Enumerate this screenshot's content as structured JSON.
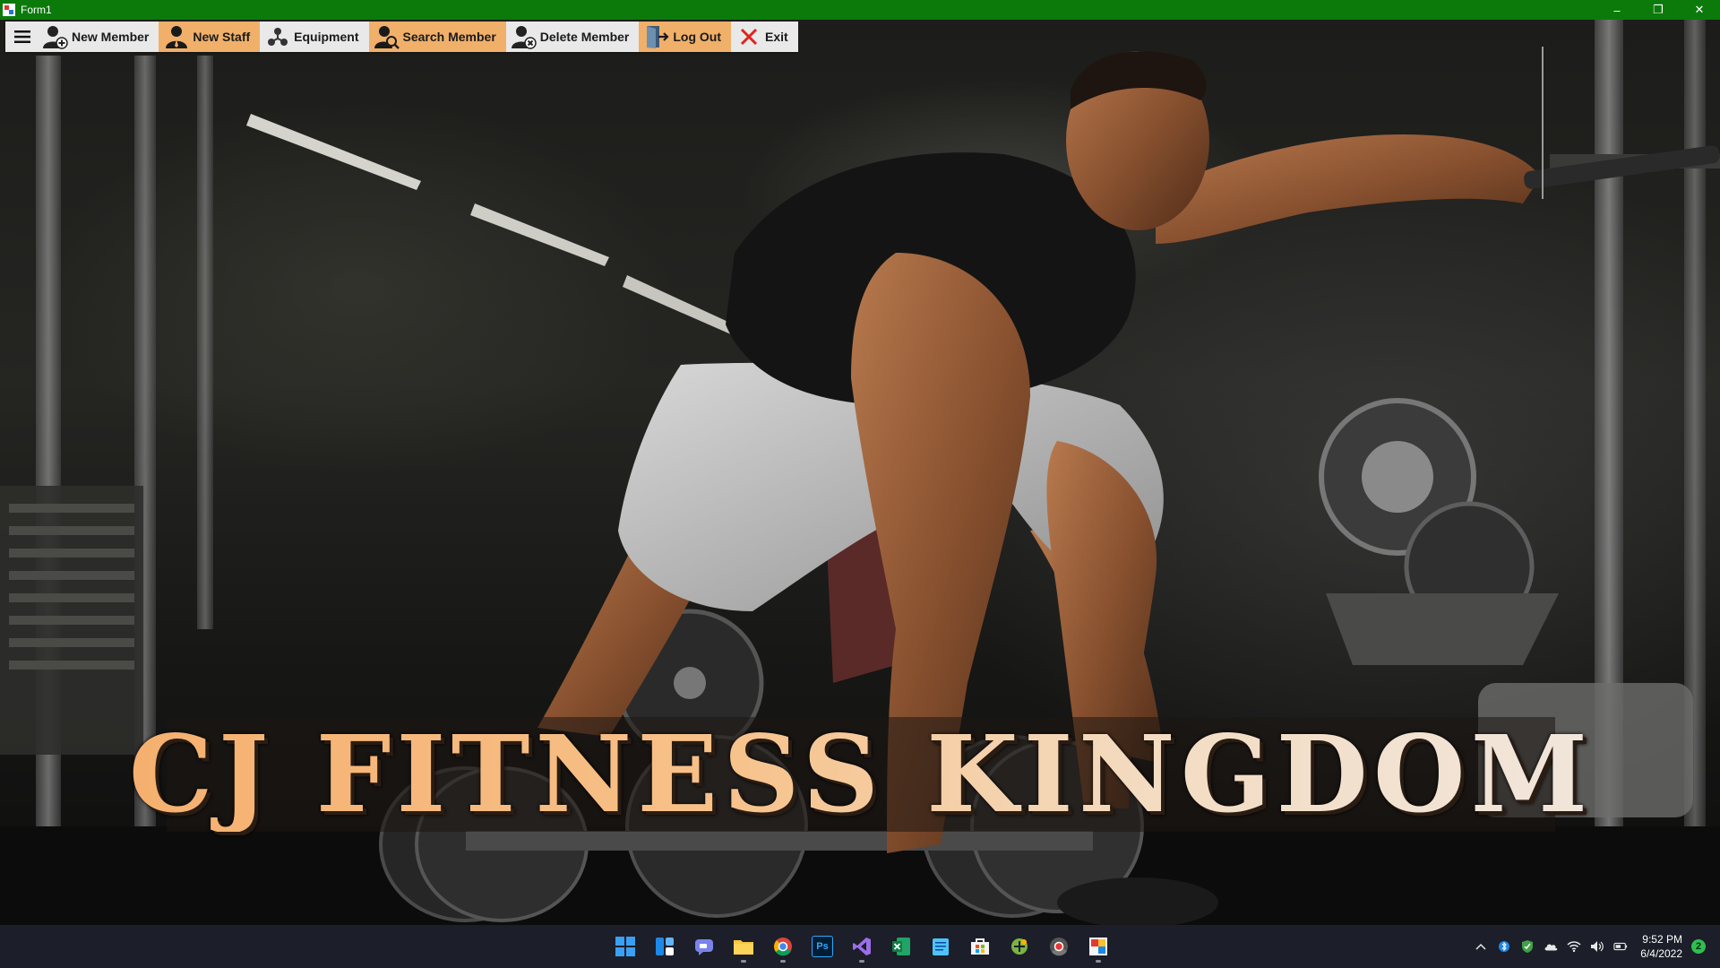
{
  "window": {
    "title": "Form1",
    "controls": {
      "minimize": "–",
      "restore": "❐",
      "close": "✕"
    }
  },
  "menu": {
    "items": [
      {
        "key": "hamburger",
        "label": "",
        "icon": "hamburger-icon"
      },
      {
        "key": "new_member",
        "label": "New Member",
        "icon": "add-user-icon"
      },
      {
        "key": "new_staff",
        "label": "New Staff",
        "icon": "staff-icon",
        "highlighted": true
      },
      {
        "key": "equipment",
        "label": "Equipment",
        "icon": "equipment-icon"
      },
      {
        "key": "search_member",
        "label": "Search Member",
        "icon": "search-user-icon",
        "highlighted": true
      },
      {
        "key": "delete_member",
        "label": "Delete Member",
        "icon": "delete-user-icon"
      },
      {
        "key": "log_out",
        "label": "Log Out",
        "icon": "logout-icon",
        "highlighted": true
      },
      {
        "key": "exit",
        "label": "Exit",
        "icon": "close-icon"
      }
    ]
  },
  "banner": {
    "text": "CJ FITNESS KINGDOM"
  },
  "colors": {
    "titlebar": "#0b7a0b",
    "menu_highlight": "#f0b06a",
    "banner_text": "#f5b06f",
    "taskbar": "#1c1e2a"
  },
  "taskbar": {
    "apps": [
      {
        "name": "windows-start-icon"
      },
      {
        "name": "widgets-icon"
      },
      {
        "name": "teams-chat-icon"
      },
      {
        "name": "file-explorer-icon",
        "running": true
      },
      {
        "name": "chrome-icon",
        "running": true
      },
      {
        "name": "photoshop-icon",
        "label": "Ps"
      },
      {
        "name": "visual-studio-icon",
        "running": true
      },
      {
        "name": "excel-icon"
      },
      {
        "name": "notepad-icon"
      },
      {
        "name": "microsoft-store-icon"
      },
      {
        "name": "app-icon"
      },
      {
        "name": "chrome-alt-icon"
      },
      {
        "name": "form-app-icon",
        "running": true
      }
    ],
    "tray": {
      "icons": [
        "chevron-up-icon",
        "bluetooth-icon",
        "defender-icon",
        "onedrive-icon",
        "wifi-icon",
        "volume-icon",
        "battery-icon"
      ],
      "time": "9:52 PM",
      "date": "6/4/2022",
      "notification_count": "2"
    }
  }
}
